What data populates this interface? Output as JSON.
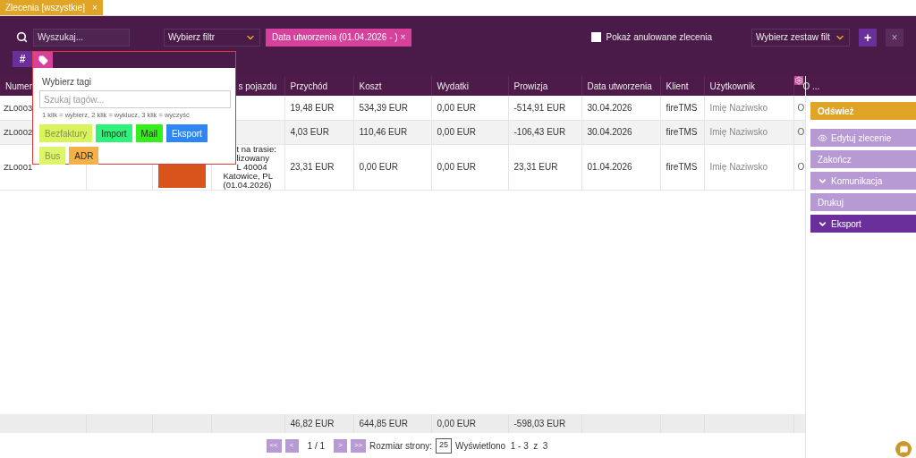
{
  "tab": {
    "label": "Zlecenia [wszystkie]",
    "close": "×"
  },
  "toolbar": {
    "search_placeholder": "Wyszukaj...",
    "filter_select": "Wybierz filtr",
    "active_filter": "Data utworzenia (01.04.2026 - ) ×",
    "show_cancelled": {
      "label": "Pokaż anulowane zlecenia",
      "checked": false
    },
    "filter_set_select": "Wybierz zestaw filt",
    "add": "+",
    "clear": "×",
    "hash": "#"
  },
  "tag_popup": {
    "title": "Wybierz tagi",
    "placeholder": "Szukaj tagów...",
    "hint": "1 klik = wybierz, 2 klik = wyklucz, 3 klik = wyczyść",
    "tags": [
      {
        "label": "Bezfaktury",
        "color": "#d9f35a",
        "muted": true
      },
      {
        "label": "Import",
        "color": "#2ef27a",
        "muted": false
      },
      {
        "label": "Mail",
        "color": "#33ef1a",
        "muted": false
      },
      {
        "label": "Eksport",
        "color": "#2e86f5",
        "muted": false
      },
      {
        "label": "Bus",
        "color": "#ddf56b",
        "muted": true
      },
      {
        "label": "ADR",
        "color": "#f5b04a",
        "muted": false
      }
    ]
  },
  "table": {
    "columns": [
      {
        "label": "Numer"
      },
      {},
      {},
      {
        "label": "s pojazdu"
      },
      {
        "label": "Przychód"
      },
      {
        "label": "Koszt"
      },
      {
        "label": "Wydatki"
      },
      {
        "label": "Prowizja"
      },
      {
        "label": "Data utworzenia"
      },
      {
        "label": "Klient"
      },
      {
        "label": "Użytkownik"
      },
      {
        "label": "O ..."
      }
    ],
    "rows": [
      {
        "cells": [
          "ZL0003",
          null,
          null,
          null,
          "19,48 EUR",
          "534,39 EUR",
          "0,00 EUR",
          "-514,91 EUR",
          "30.04.2026",
          "fireTMS",
          "Imię Naziwsko",
          "O"
        ]
      },
      {
        "cells": [
          "ZL0002",
          null,
          null,
          null,
          "4,03 EUR",
          "110,46 EUR",
          "0,00 EUR",
          "-106,43 EUR",
          "30.04.2026",
          "fireTMS",
          "Imię Naziwsko",
          "O"
        ]
      },
      {
        "cells": [
          "ZL0001",
          null,
          null,
          [
            "t na trasie:",
            "lizowany",
            "L 40004",
            "Katowice, PL",
            "(01.04.2026)"
          ],
          "23,31 EUR",
          "0,00 EUR",
          "0,00 EUR",
          "23,31 EUR",
          "01.04.2026",
          "fireTMS",
          "Imię Naziwsko",
          "O"
        ],
        "color": "#d8541c"
      }
    ],
    "totals": {
      "przychod": "46,82 EUR",
      "koszt": "644,85 EUR",
      "wydatki": "0,00 EUR",
      "prowizja": "-598,03 EUR"
    }
  },
  "actions": [
    {
      "label": "Odśwież",
      "kind": "primary"
    },
    {
      "label": "Edytuj zlecenie",
      "kind": "view"
    },
    {
      "label": "Zakończ",
      "kind": "secondary"
    },
    {
      "label": "Komunikacja",
      "kind": "secondary",
      "expandable": true
    },
    {
      "label": "Drukuj",
      "kind": "secondary"
    },
    {
      "label": "Eksport",
      "kind": "dark",
      "expandable": true
    }
  ],
  "pagination": {
    "first": "<<",
    "prev": "<",
    "page": "1 / 1",
    "next": ">",
    "last": ">>",
    "size_label": "Rozmiar strony:",
    "size": "25",
    "summary": "Wyświetlono  1 - 3  z  3"
  }
}
